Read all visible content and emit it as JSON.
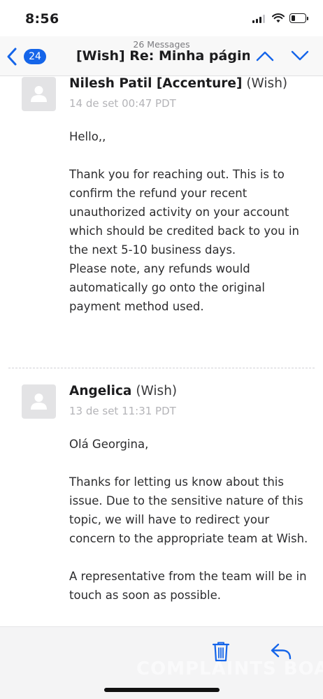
{
  "status_bar": {
    "time": "8:56",
    "battery_level": 0.35
  },
  "nav": {
    "back_badge": "24",
    "message_count": "26 Messages",
    "title": "[Wish] Re: Minha págin..."
  },
  "messages": [
    {
      "sender_name": "Nilesh Patil [Accenture]",
      "sender_org": "(Wish)",
      "date": "14 de set 00:47 PDT",
      "body": [
        "Hello,,",
        "Thank you for reaching out. This is to confirm the refund your recent unauthorized activity on your account which should be credited back to you in the next 5-10 business days.",
        "Please note, any refunds would automatically go onto the original payment method used."
      ]
    },
    {
      "sender_name": "Angelica",
      "sender_org": "(Wish)",
      "date": "13 de set 11:31 PDT",
      "body": [
        "Olá Georgina,",
        "Thanks for letting us know about this issue. Due to the sensitive nature of this topic, we will have to redirect your concern to the appropriate team at Wish.",
        "A representative from the team will be in touch as soon as possible."
      ]
    }
  ],
  "watermark": "COMPLAINTS BOARD",
  "colors": {
    "accent": "#1565e9",
    "badge": "#1565e9"
  },
  "icons": [
    "back-chevron-icon",
    "chevron-up-icon",
    "chevron-down-icon",
    "trash-icon",
    "reply-icon",
    "person-icon",
    "signal-icon",
    "wifi-icon",
    "battery-icon"
  ]
}
